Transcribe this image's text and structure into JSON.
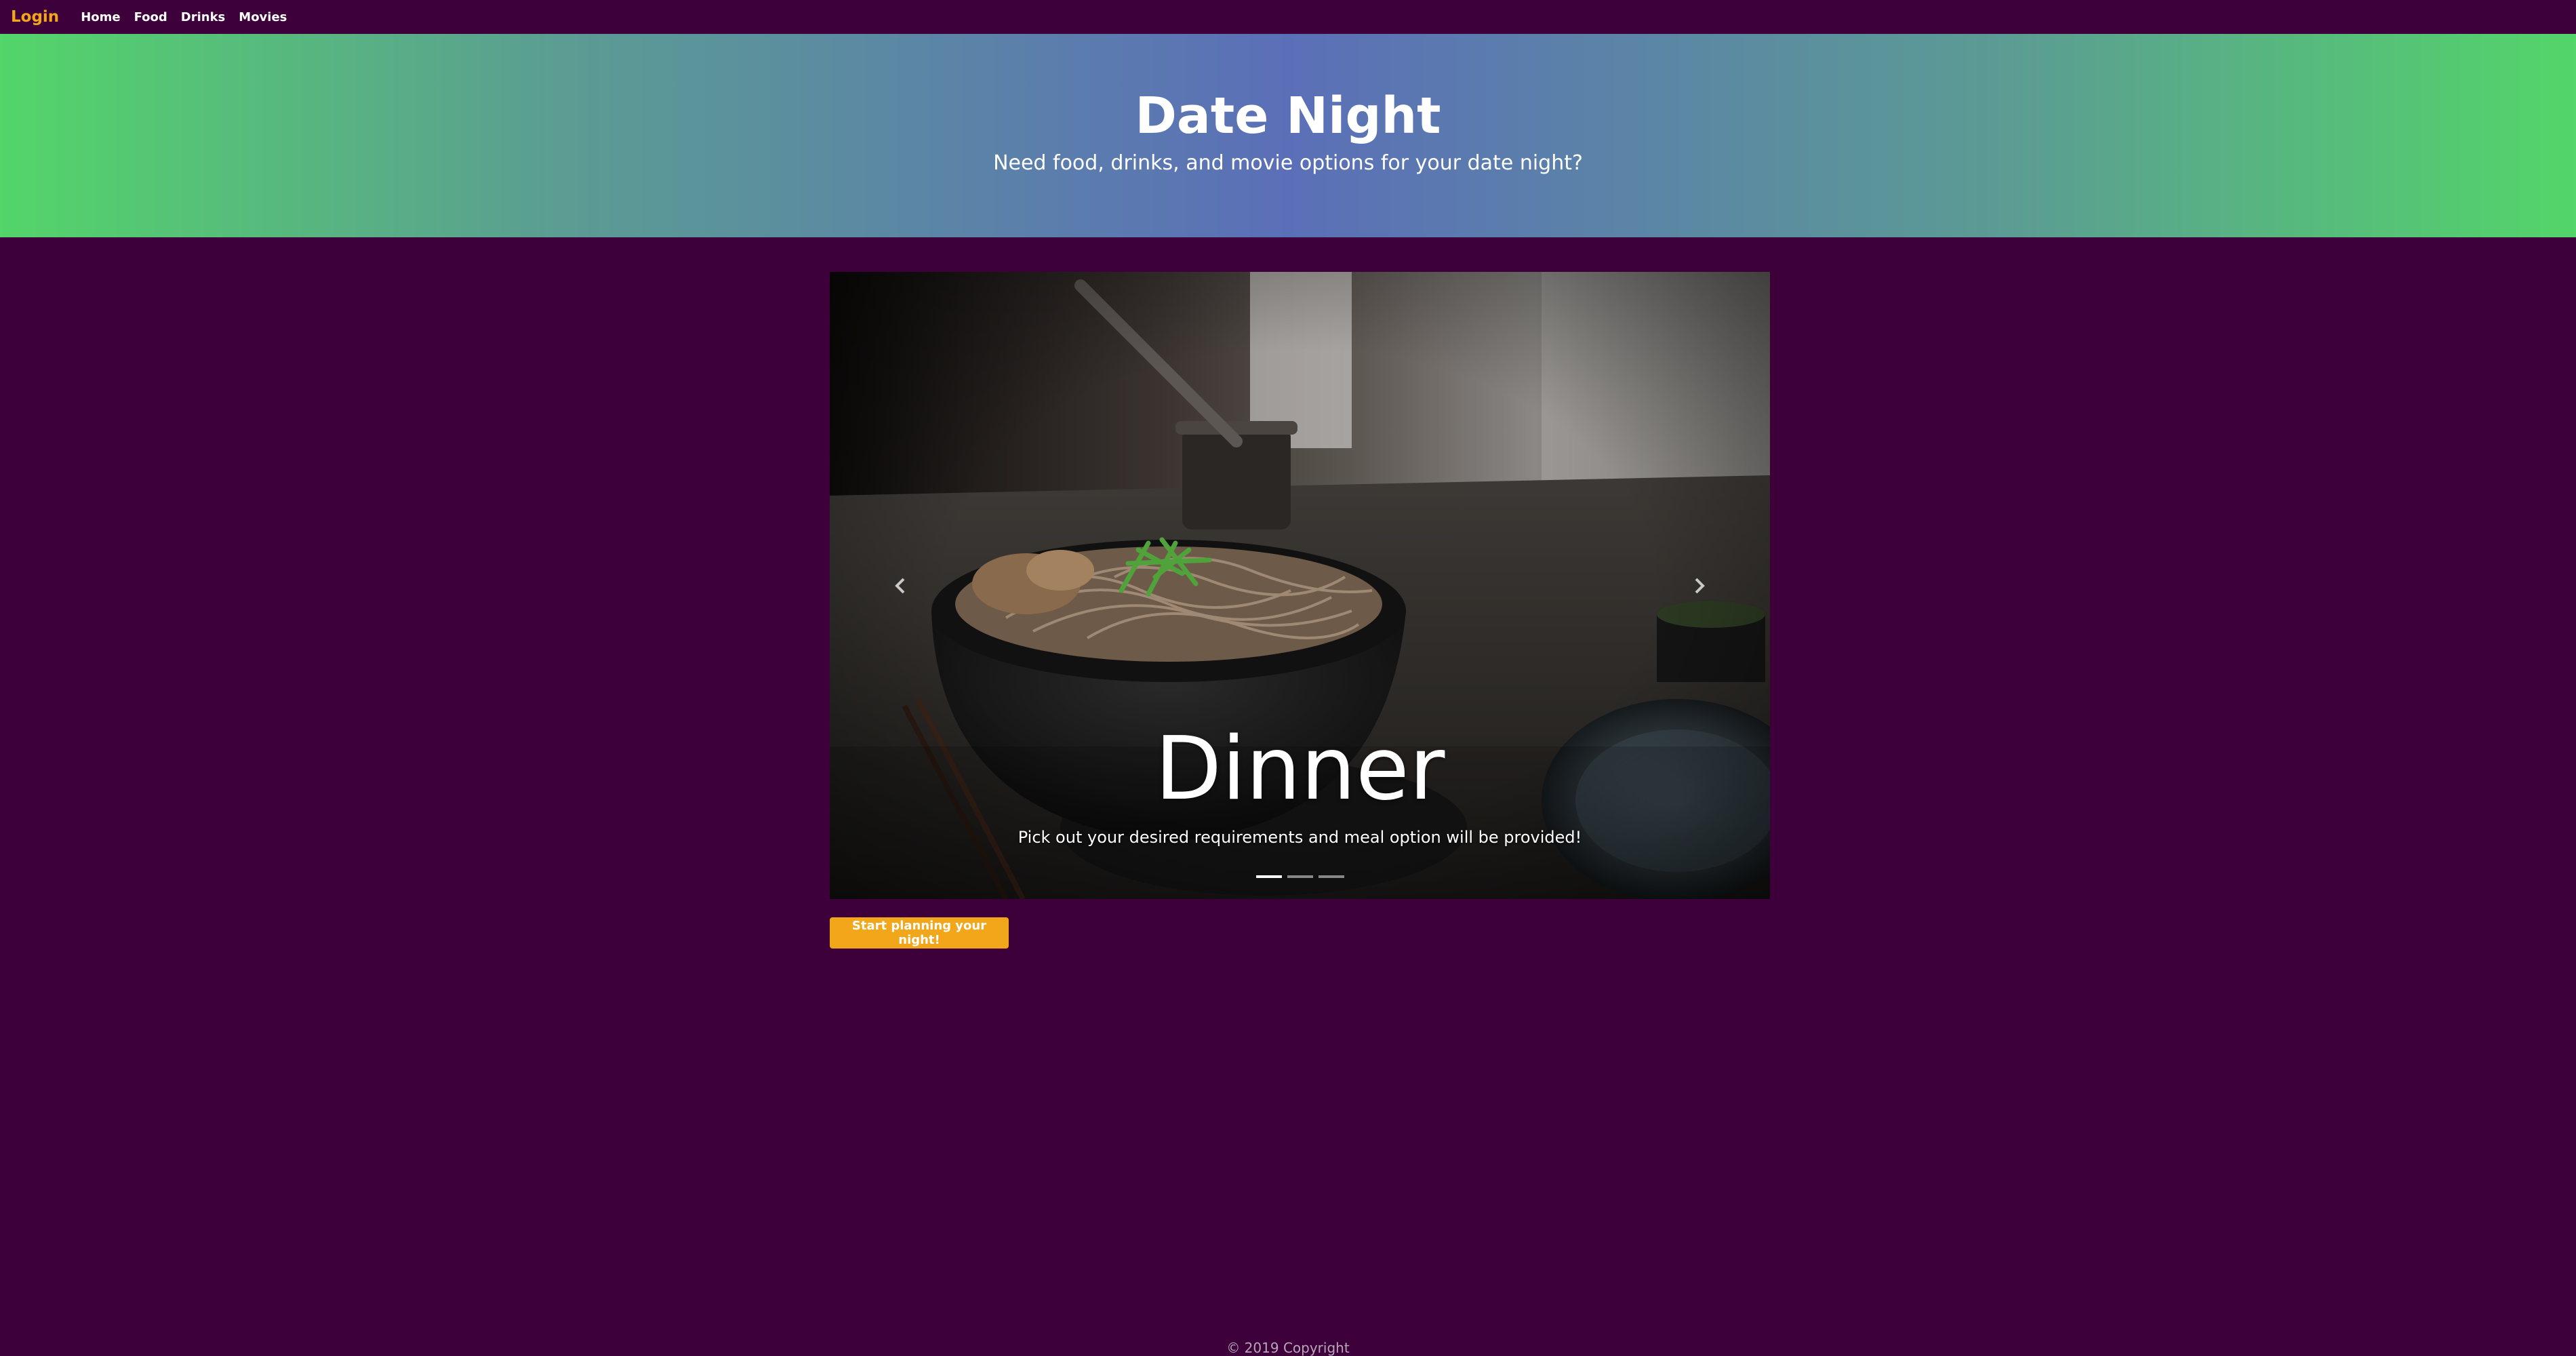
{
  "navbar": {
    "brand": "Login",
    "links": [
      "Home",
      "Food",
      "Drinks",
      "Movies"
    ]
  },
  "hero": {
    "title": "Date Night",
    "subtitle": "Need food, drinks, and movie options for your date night?"
  },
  "carousel": {
    "active_index": 0,
    "slide_count": 3,
    "caption_title": "Dinner",
    "caption_text": "Pick out your desired requirements and meal option will be provided!"
  },
  "cta": {
    "label": "Start planning your night!"
  },
  "footer": {
    "text": "© 2019 Copyright"
  },
  "colors": {
    "background": "#3d003b",
    "accent": "#f2a71b",
    "hero_gradient_edge": "#53d569",
    "hero_gradient_center": "#5b6fb8"
  }
}
